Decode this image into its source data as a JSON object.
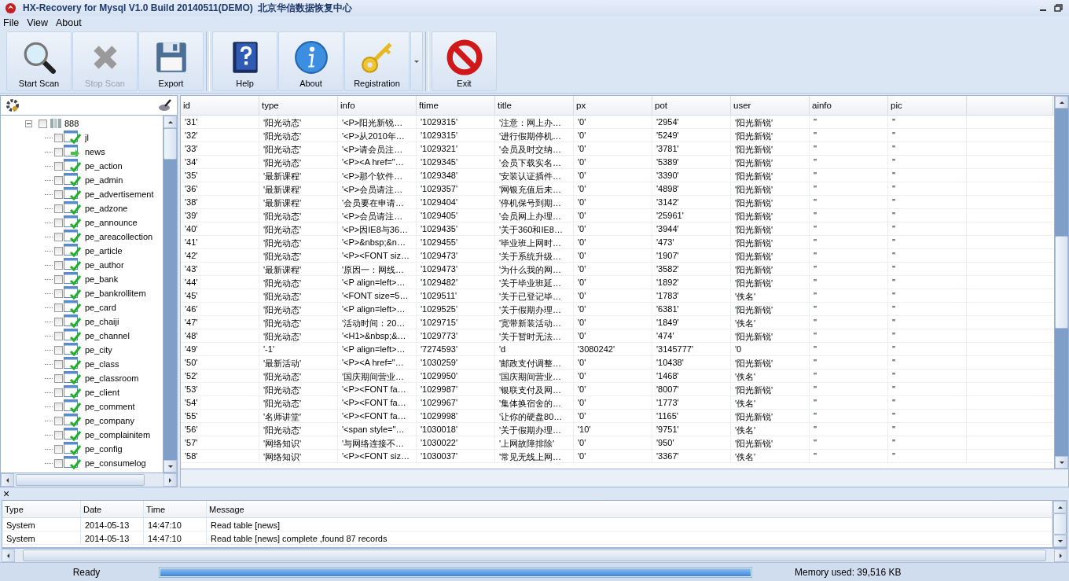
{
  "window": {
    "title": "HX-Recovery for Mysql V1.0 Build 20140511(DEMO)  北京华信数据恢复中心"
  },
  "menu": [
    "File",
    "View",
    "About"
  ],
  "toolbar": [
    {
      "label": "Start Scan",
      "kind": "search",
      "disabled": false
    },
    {
      "label": "Stop Scan",
      "kind": "stop",
      "disabled": true
    },
    {
      "label": "Export",
      "kind": "export",
      "disabled": false
    },
    {
      "label": "Help",
      "kind": "help",
      "disabled": false
    },
    {
      "label": "About",
      "kind": "about",
      "disabled": false
    },
    {
      "label": "Registration",
      "kind": "key",
      "disabled": false
    },
    {
      "label": "Exit",
      "kind": "exit",
      "disabled": false
    }
  ],
  "tree": {
    "label": "888",
    "expanded": true,
    "checked": false,
    "children": [
      {
        "label": "jl",
        "checked": false,
        "current": false
      },
      {
        "label": "news",
        "checked": false,
        "current": true
      },
      {
        "label": "pe_action",
        "checked": false,
        "current": false
      },
      {
        "label": "pe_admin",
        "checked": false,
        "current": false
      },
      {
        "label": "pe_advertisement",
        "checked": false,
        "current": false
      },
      {
        "label": "pe_adzone",
        "checked": false,
        "current": false
      },
      {
        "label": "pe_announce",
        "checked": false,
        "current": false
      },
      {
        "label": "pe_areacollection",
        "checked": false,
        "current": false
      },
      {
        "label": "pe_article",
        "checked": false,
        "current": false
      },
      {
        "label": "pe_author",
        "checked": false,
        "current": false
      },
      {
        "label": "pe_bank",
        "checked": false,
        "current": false
      },
      {
        "label": "pe_bankrollitem",
        "checked": false,
        "current": false
      },
      {
        "label": "pe_card",
        "checked": false,
        "current": false
      },
      {
        "label": "pe_chaiji",
        "checked": false,
        "current": false
      },
      {
        "label": "pe_channel",
        "checked": false,
        "current": false
      },
      {
        "label": "pe_city",
        "checked": false,
        "current": false
      },
      {
        "label": "pe_class",
        "checked": false,
        "current": false
      },
      {
        "label": "pe_classroom",
        "checked": false,
        "current": false
      },
      {
        "label": "pe_client",
        "checked": false,
        "current": false
      },
      {
        "label": "pe_comment",
        "checked": false,
        "current": false
      },
      {
        "label": "pe_company",
        "checked": false,
        "current": false
      },
      {
        "label": "pe_complainitem",
        "checked": false,
        "current": false
      },
      {
        "label": "pe_config",
        "checked": false,
        "current": false
      },
      {
        "label": "pe_consumelog",
        "checked": false,
        "current": false
      }
    ]
  },
  "table": {
    "columns": [
      "id",
      "type",
      "info",
      "ftime",
      "title",
      "px",
      "pot",
      "user",
      "ainfo",
      "pic"
    ],
    "rows": [
      [
        "'31'",
        "'阳光动态'",
        "'<P>阳光新锐…",
        "'1029315'",
        "'注意：网上办…",
        "'0'",
        "'2954'",
        "'阳光新锐'",
        "''",
        "''"
      ],
      [
        "'32'",
        "'阳光动态'",
        "'<P>从2010年…",
        "'1029315'",
        "'进行假期停机…",
        "'0'",
        "'5249'",
        "'阳光新锐'",
        "''",
        "''"
      ],
      [
        "'33'",
        "'阳光动态'",
        "'<P>请会员注…",
        "'1029321'",
        "'会员及时交纳…",
        "'0'",
        "'3781'",
        "'阳光新锐'",
        "''",
        "''"
      ],
      [
        "'34'",
        "'阳光动态'",
        "'<P><A href=\"…",
        "'1029345'",
        "'会员下载实名…",
        "'0'",
        "'5389'",
        "'阳光新锐'",
        "''",
        "''"
      ],
      [
        "'35'",
        "'最新课程'",
        "'<P>那个软件…",
        "'1029348'",
        "'安装认证插件…",
        "'0'",
        "'3390'",
        "'阳光新锐'",
        "''",
        "''"
      ],
      [
        "'36'",
        "'最新课程'",
        "'<P>会员请注…",
        "'1029357'",
        "'网银充值后未…",
        "'0'",
        "'4898'",
        "'阳光新锐'",
        "''",
        "''"
      ],
      [
        "'38'",
        "'最新课程'",
        "'会员要在申请…",
        "'1029404'",
        "'停机保号到期…",
        "'0'",
        "'3142'",
        "'阳光新锐'",
        "''",
        "''"
      ],
      [
        "'39'",
        "'阳光动态'",
        "'<P>会员请注…",
        "'1029405'",
        "'会员网上办理…",
        "'0'",
        "'25961'",
        "'阳光新锐'",
        "''",
        "''"
      ],
      [
        "'40'",
        "'阳光动态'",
        "'<P>因IE8与36…",
        "'1029435'",
        "'关于360和IE8…",
        "'0'",
        "'3944'",
        "'阳光新锐'",
        "''",
        "''"
      ],
      [
        "'41'",
        "'阳光动态'",
        "'<P>&nbsp;&n…",
        "'1029455'",
        "'毕业班上网时…",
        "'0'",
        "'473'",
        "'阳光新锐'",
        "''",
        "''"
      ],
      [
        "'42'",
        "'阳光动态'",
        "'<P><FONT siz…",
        "'1029473'",
        "'关于系统升级…",
        "'0'",
        "'1907'",
        "'阳光新锐'",
        "''",
        "''"
      ],
      [
        "'43'",
        "'最新课程'",
        "'原因一：网线…",
        "'1029473'",
        "'为什么我的网…",
        "'0'",
        "'3582'",
        "'阳光新锐'",
        "''",
        "''"
      ],
      [
        "'44'",
        "'阳光动态'",
        "'<P align=left>…",
        "'1029482'",
        "'关于毕业班延…",
        "'0'",
        "'1892'",
        "'阳光新锐'",
        "''",
        "''"
      ],
      [
        "'45'",
        "'阳光动态'",
        "'<FONT size=5…",
        "'1029511'",
        "'关于已登记毕…",
        "'0'",
        "'1783'",
        "'佚名'",
        "''",
        "''"
      ],
      [
        "'46'",
        "'阳光动态'",
        "'<P align=left>…",
        "'1029525'",
        "'关于假期办理…",
        "'0'",
        "'6381'",
        "'阳光新锐'",
        "''",
        "''"
      ],
      [
        "'47'",
        "'阳光动态'",
        "'活动时间：20…",
        "'1029715'",
        "'宽带新装活动…",
        "'0'",
        "'1849'",
        "'佚名'",
        "''",
        "''"
      ],
      [
        "'48'",
        "'阳光动态'",
        "'<H1>&nbsp;&…",
        "'1029773'",
        "'关于暂时无法…",
        "'0'",
        "'474'",
        "'阳光新锐'",
        "''",
        "''"
      ],
      [
        "'49'",
        "'-1'",
        "'<P align=left>…",
        "'7274593'",
        "'d",
        "'3080242'",
        "'3145777'",
        "'0",
        "''",
        "''"
      ],
      [
        "'50'",
        "'最新活动'",
        "'<P><A href=\"…",
        "'1030259'",
        "'邮政支付调整…",
        "'0'",
        "'10438'",
        "'阳光新锐'",
        "''",
        "''"
      ],
      [
        "'52'",
        "'阳光动态'",
        "'国庆期间营业…",
        "'1029950'",
        "'国庆期间营业…",
        "'0'",
        "'1468'",
        "'佚名'",
        "''",
        "''"
      ],
      [
        "'53'",
        "'阳光动态'",
        "'<P><FONT fa…",
        "'1029987'",
        "'银联支付及网…",
        "'0'",
        "'8007'",
        "'阳光新锐'",
        "''",
        "''"
      ],
      [
        "'54'",
        "'阳光动态'",
        "'<P><FONT fa…",
        "'1029967'",
        "'集体换宿舍的…",
        "'0'",
        "'1773'",
        "'佚名'",
        "''",
        "''"
      ],
      [
        "'55'",
        "'名师讲堂'",
        "'<P><FONT fa…",
        "'1029998'",
        "'让你的硬盘80…",
        "'0'",
        "'1165'",
        "'阳光新锐'",
        "''",
        "''"
      ],
      [
        "'56'",
        "'阳光动态'",
        "'<span style=\"…",
        "'1030018'",
        "'关于假期办理…",
        "'10'",
        "'9751'",
        "'佚名'",
        "''",
        "''"
      ],
      [
        "'57'",
        "'网络知识'",
        "'与网络连接不…",
        "'1030022'",
        "'上网故障排除'",
        "'0'",
        "'950'",
        "'阳光新锐'",
        "''",
        "''"
      ],
      [
        "'58'",
        "'网络知识'",
        "'<P><FONT siz…",
        "'1030037'",
        "'常见无线上网…",
        "'0'",
        "'3367'",
        "'佚名'",
        "''",
        "''"
      ]
    ]
  },
  "log": {
    "close": "×",
    "columns": [
      "Type",
      "Date",
      "Time",
      "Message"
    ],
    "rows": [
      [
        "System",
        "2014-05-13",
        "14:47:10",
        "Read table [news]"
      ],
      [
        "System",
        "2014-05-13",
        "14:47:10",
        "Read table [news] complete ,found 87 records"
      ]
    ]
  },
  "status_bar": {
    "text": "Ready",
    "progress": {
      "level": 1
    },
    "memory": "Memory used: 39,516 KB"
  }
}
